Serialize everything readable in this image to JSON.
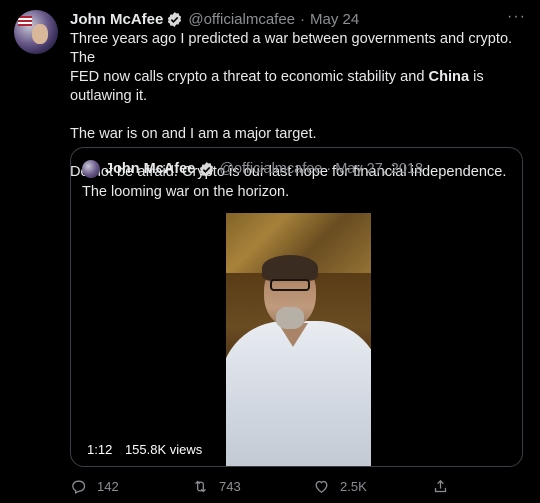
{
  "tweet": {
    "author_name": "John McAfee",
    "author_handle": "@officialmcafee",
    "separator": "·",
    "date": "May 24",
    "more_label": "···",
    "line1": "Three years ago I predicted a war between governments and crypto. The",
    "line2_a": "FED now calls crypto a threat to economic stability and ",
    "line2_bold": "China",
    "line2_b": " is outlawing it.",
    "line3": "The war is on and I am a major target.",
    "line4": "Do not be afraid. Crypto is our last hope for financial independence."
  },
  "quoted": {
    "author_name": "John McAfee",
    "author_handle": "@officialmcafee",
    "separator": "·",
    "date": "May 27, 2018",
    "text": "The looming war on the horizon.",
    "video": {
      "duration": "1:12",
      "views": "155.8K views"
    }
  },
  "actions": {
    "reply_count": "142",
    "retweet_count": "743",
    "like_count": "2.5K",
    "reply_icon": "reply-icon",
    "retweet_icon": "retweet-icon",
    "like_icon": "heart-icon",
    "share_icon": "share-icon"
  },
  "colors": {
    "background": "#000000",
    "text": "#e7e9ea",
    "muted": "#8b8f94",
    "verified": "#d9d9d9",
    "border": "#3b3f44"
  }
}
